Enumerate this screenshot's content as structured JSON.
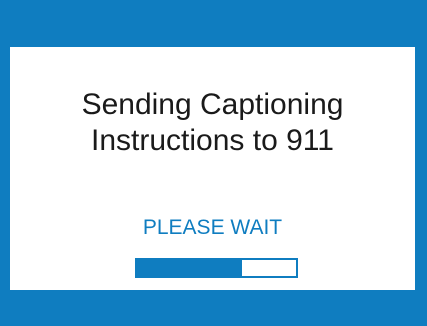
{
  "screen": {
    "message_line_1": "Sending Captioning",
    "message_line_2": "Instructions to 911",
    "wait_label": "PLEASE WAIT"
  },
  "progress": {
    "fraction": 0.66
  },
  "colors": {
    "accent": "#0f7dc0",
    "text": "#1a1a1a",
    "panel": "#ffffff"
  }
}
